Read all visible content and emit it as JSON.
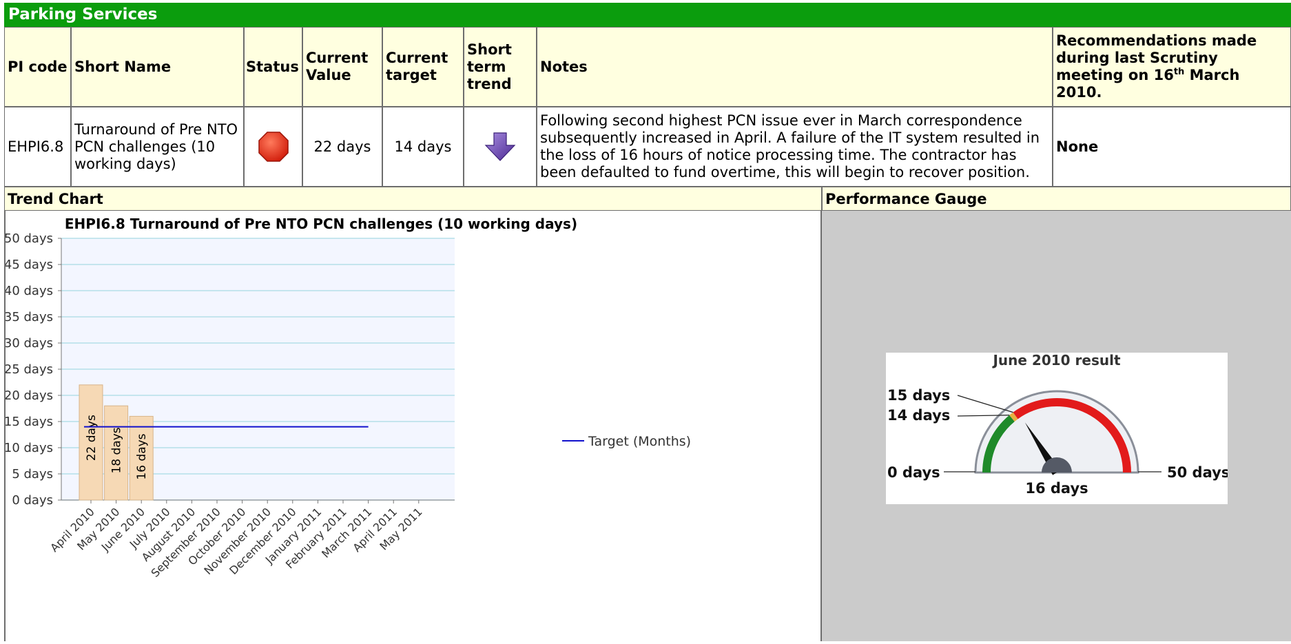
{
  "section_title": "Parking Services",
  "table": {
    "headers": {
      "pi_code": "PI code",
      "short_name": "Short Name",
      "status": "Status",
      "current_value": "Current Value",
      "current_target": "Current target",
      "short_term_trend": "Short term trend",
      "notes": "Notes",
      "recommendations_pre": "Recommendations made during last Scrutiny meeting on 16",
      "recommendations_sup": "th",
      "recommendations_post": " March 2010."
    },
    "row": {
      "pi_code": "EHPI6.8",
      "short_name": "Turnaround of Pre NTO PCN challenges (10 working days)",
      "status_icon": "red-stop-octagon-icon",
      "status_color": "#e8231a",
      "current_value": "22 days",
      "current_target": "14 days",
      "trend_icon": "purple-down-arrow-icon",
      "trend_color": "#6a3aa8",
      "notes": "Following second highest PCN issue ever in March correspondence subsequently increased in April. A failure of the IT system resulted in the loss of 16 hours of notice processing time. The contractor has been defaulted to fund overtime, this will begin to recover position.",
      "recommendations": "None"
    }
  },
  "trend_chart_label": "Trend Chart",
  "performance_gauge_label": "Performance Gauge",
  "chart_data": {
    "type": "bar",
    "title": "EHPI6.8 Turnaround of Pre NTO PCN challenges (10 working days)",
    "categories": [
      "April 2010",
      "May 2010",
      "June 2010",
      "July 2010",
      "August 2010",
      "September 2010",
      "October 2010",
      "November 2010",
      "December 2010",
      "January 2011",
      "February 2011",
      "March 2011",
      "April 2011",
      "May 2011"
    ],
    "values": [
      22,
      18,
      16,
      null,
      null,
      null,
      null,
      null,
      null,
      null,
      null,
      null,
      null,
      null
    ],
    "data_labels": [
      "22 days",
      "18 days",
      "16 days"
    ],
    "target": {
      "name": "Target (Months)",
      "value": 14,
      "from": "April 2010",
      "to": "March 2011",
      "color": "#1010cc"
    },
    "yticks": [
      "0 days",
      "5 days",
      "10 days",
      "15 days",
      "20 days",
      "25 days",
      "30 days",
      "35 days",
      "40 days",
      "45 days",
      "50 days"
    ],
    "ylim": [
      0,
      50
    ],
    "grid": true,
    "legend_position": "right",
    "bar_color": "#f6d9b5",
    "plot_bg": "#f3f6ff"
  },
  "gauge": {
    "title": "June 2010 result",
    "value": 16,
    "min": 0,
    "max": 50,
    "green_to": 14,
    "amber_to": 15,
    "labels": {
      "min": "0 days",
      "max": "50 days",
      "target": "14 days",
      "amber": "15 days",
      "value": "16 days"
    },
    "colors": {
      "green": "#1f8a2a",
      "amber": "#e8b040",
      "red": "#e21b1b"
    }
  }
}
